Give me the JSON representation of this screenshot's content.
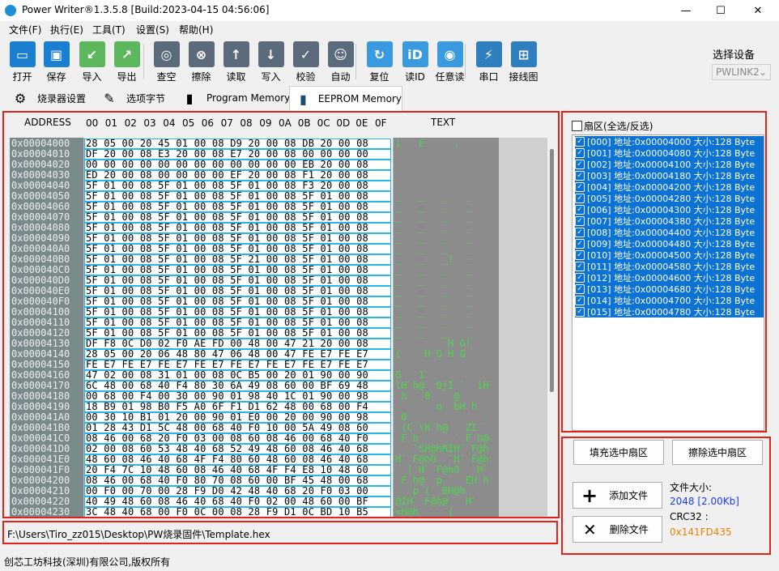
{
  "title": "Power Writer®1.3.5.8 [Build:2023-04-15 04:56:06]",
  "window": {
    "minimize": "—",
    "maximize": "☐",
    "close": "✕"
  },
  "menu": [
    "文件(F)",
    "执行(E)",
    "工具(T)",
    "设置(S)",
    "帮助(H)"
  ],
  "toolbar": [
    {
      "label": "打开",
      "icon": "folder-open-icon",
      "color": "#1b7fd1",
      "glyph": "▭"
    },
    {
      "label": "保存",
      "icon": "save-icon",
      "color": "#1b7fd1",
      "glyph": "▣"
    },
    {
      "label": "导入",
      "icon": "import-icon",
      "color": "#5db85d",
      "glyph": "↙"
    },
    {
      "label": "导出",
      "icon": "export-icon",
      "color": "#5db85d",
      "glyph": "↗"
    },
    {
      "label": "查空",
      "icon": "search-icon",
      "color": "#5b6b7b",
      "glyph": "◎"
    },
    {
      "label": "擦除",
      "icon": "erase-icon",
      "color": "#5b6b7b",
      "glyph": "⊗"
    },
    {
      "label": "读取",
      "icon": "read-icon",
      "color": "#5b6b7b",
      "glyph": "↑"
    },
    {
      "label": "写入",
      "icon": "write-icon",
      "color": "#5b6b7b",
      "glyph": "↓"
    },
    {
      "label": "校验",
      "icon": "verify-icon",
      "color": "#5b6b7b",
      "glyph": "✓"
    },
    {
      "label": "自动",
      "icon": "robot-icon",
      "color": "#5b6b7b",
      "glyph": "☺"
    },
    {
      "label": "复位",
      "icon": "reset-icon",
      "color": "#3a9ae0",
      "glyph": "↻"
    },
    {
      "label": "读ID",
      "icon": "id-icon",
      "color": "#3a9ae0",
      "glyph": "iD"
    },
    {
      "label": "任意读",
      "icon": "random-read-icon",
      "color": "#3a9ae0",
      "glyph": "◉"
    },
    {
      "label": "串口",
      "icon": "serial-port-icon",
      "color": "#2f7fbf",
      "glyph": "⚡"
    },
    {
      "label": "接线图",
      "icon": "wiring-diagram-icon",
      "color": "#2f7fbf",
      "glyph": "⊞"
    }
  ],
  "device": {
    "label": "选择设备",
    "value": "PWLINK2"
  },
  "tabs": [
    {
      "label": "烧录器设置",
      "icon": "gear-icon"
    },
    {
      "label": "选项字节",
      "icon": "options-icon"
    },
    {
      "label": "Program Memory",
      "icon": "chip-icon"
    },
    {
      "label": "EEPROM Memory",
      "icon": "chip-icon"
    }
  ],
  "mem_header": {
    "address": "ADDRESS",
    "cols": [
      "00",
      "01",
      "02",
      "03",
      "04",
      "05",
      "06",
      "07",
      "08",
      "09",
      "0A",
      "0B",
      "0C",
      "0D",
      "0E",
      "0F"
    ],
    "text": "TEXT"
  },
  "mem_rows": [
    {
      "a": "0x00004000",
      "h": "28 05 00 20 45 01 00 08 D9 20 00 08 DB 20 00 08",
      "t": "(   E     ."
    },
    {
      "a": "0x00004010",
      "h": "DF 20 00 08 E3 20 00 08 E7 20 00 08 00 00 00 00",
      "t": ""
    },
    {
      "a": "0x00004020",
      "h": "00 00 00 00 00 00 00 00 00 00 00 00 EB 20 00 08",
      "t": ""
    },
    {
      "a": "0x00004030",
      "h": "ED 20 00 08 00 00 00 00 EF 20 00 08 F1 20 00 08",
      "t": ""
    },
    {
      "a": "0x00004040",
      "h": "5F 01 00 08 5F 01 00 08 5F 01 00 08 F3 20 00 08",
      "t": ""
    },
    {
      "a": "0x00004050",
      "h": "5F 01 00 08 5F 01 00 08 5F 01 00 08 5F 01 00 08",
      "t": "_   _   _   _"
    },
    {
      "a": "0x00004060",
      "h": "5F 01 00 08 5F 01 00 08 5F 01 00 08 5F 01 00 08",
      "t": "_   _   _   _"
    },
    {
      "a": "0x00004070",
      "h": "5F 01 00 08 5F 01 00 08 5F 01 00 08 5F 01 00 08",
      "t": "_   _   _   _"
    },
    {
      "a": "0x00004080",
      "h": "5F 01 00 08 5F 01 00 08 5F 01 00 08 5F 01 00 08",
      "t": "_   _   _   _"
    },
    {
      "a": "0x00004090",
      "h": "5F 01 00 08 5F 01 00 08 5F 01 00 08 5F 01 00 08",
      "t": "_   _   _   _"
    },
    {
      "a": "0x000040A0",
      "h": "5F 01 00 08 5F 01 00 08 5F 01 00 08 5F 01 00 08",
      "t": "_   _   _   _"
    },
    {
      "a": "0x000040B0",
      "h": "5F 01 00 08 5F 01 00 08 5F 21 00 08 5F 01 00 08",
      "t": "_   _   _!  _"
    },
    {
      "a": "0x000040C0",
      "h": "5F 01 00 08 5F 01 00 08 5F 01 00 08 5F 01 00 08",
      "t": "_   _   _   _"
    },
    {
      "a": "0x000040D0",
      "h": "5F 01 00 08 5F 01 00 08 5F 01 00 08 5F 01 00 08",
      "t": "_   _   _   _"
    },
    {
      "a": "0x000040E0",
      "h": "5F 01 00 08 5F 01 00 08 5F 01 00 08 5F 01 00 08",
      "t": "_   _   _   _"
    },
    {
      "a": "0x000040F0",
      "h": "5F 01 00 08 5F 01 00 08 5F 01 00 08 5F 01 00 08",
      "t": "_   _   _   _"
    },
    {
      "a": "0x00004100",
      "h": "5F 01 00 08 5F 01 00 08 5F 01 00 08 5F 01 00 08",
      "t": "_   _   _   _"
    },
    {
      "a": "0x00004110",
      "h": "5F 01 00 08 5F 01 00 08 5F 01 00 08 5F 01 00 08",
      "t": "_   _   _   _"
    },
    {
      "a": "0x00004120",
      "h": "5F 01 00 08 5F 01 00 08 5F 01 00 08 5F 01 00 08",
      "t": "_   _   _   _"
    },
    {
      "a": "0x00004130",
      "h": "DF F8 0C D0 02 F0 AE FD 00 48 00 47 21 20 00 08",
      "t": "         H G!"
    },
    {
      "a": "0x00004140",
      "h": "28 05 00 20 06 48 80 47 06 48 00 47 FE E7 FE E7",
      "t": "(    H G H G"
    },
    {
      "a": "0x00004150",
      "h": "FE E7 FE E7 FE E7 FE E7 FE E7 FE E7 FE E7 FE E7",
      "t": ""
    },
    {
      "a": "0x00004160",
      "h": "47 02 00 08 31 01 00 08 0C B5 00 20 01 90 00 90",
      "t": "G   1"
    },
    {
      "a": "0x00004170",
      "h": "6C 48 00 68 40 F4 80 30 6A 49 08 60 00 BF 69 48",
      "t": "lH h@  0jI `  iH"
    },
    {
      "a": "0x00004180",
      "h": "00 68 00 F4 00 30 00 90 01 98 40 1C 01 90 00 98",
      "t": " h   0    @"
    },
    {
      "a": "0x00004190",
      "h": "18 B9 01 98 B0 F5 A0 6F F1 D1 62 48 00 68 00 F4",
      "t": "       o  bH h"
    },
    {
      "a": "0x000041A0",
      "h": "00 30 10 B1 01 20 00 90 01 E0 00 20 00 90 00 98",
      "t": " 0"
    },
    {
      "a": "0x000041B0",
      "h": "01 28 43 D1 5C 48 00 68 40 F0 10 00 5A 49 08 60",
      "t": " (C \\H h@   ZI `"
    },
    {
      "a": "0x000041C0",
      "h": "08 46 00 68 20 F0 03 00 08 60 08 46 00 68 40 F0",
      "t": " F h      ` F h@"
    },
    {
      "a": "0x000041D0",
      "h": "02 00 08 60 53 48 40 68 52 49 48 60 08 46 40 68",
      "t": "   `SH@hRIH` F@h"
    },
    {
      "a": "0x000041E0",
      "h": "48 60 08 46 40 68 4F F4 80 60 48 60 08 46 40 68",
      "t": "H` F@hO  `H` F@h"
    },
    {
      "a": "0x000041F0",
      "h": "20 F4 7C 10 48 60 08 46 40 68 4F F4 E8 10 48 60",
      "t": "  | H` F@hO   H`"
    },
    {
      "a": "0x00004200",
      "h": "08 46 00 68 40 F0 80 70 08 60 00 BF 45 48 00 68",
      "t": " F h@  p `  EH h"
    },
    {
      "a": "0x00004210",
      "h": "00 F0 00 70 00 28 F9 D0 42 48 40 68 20 F0 03 00",
      "t": "   p (  BH@h"
    },
    {
      "a": "0x00004220",
      "h": "40 49 48 60 08 46 40 68 40 F0 02 00 48 60 00 BF",
      "t": "@IH` F@h@   H`"
    },
    {
      "a": "0x00004230",
      "h": "3C 48 40 68 00 F0 0C 00 08 28 F9 D1 0C BD 10 B5",
      "t": "<H@h     ("
    }
  ],
  "sector_header": "扇区(全选/反选)",
  "sectors": [
    "[000] 地址:0x00004000 大小:128 Byte",
    "[001] 地址:0x00004080 大小:128 Byte",
    "[002] 地址:0x00004100 大小:128 Byte",
    "[003] 地址:0x00004180 大小:128 Byte",
    "[004] 地址:0x00004200 大小:128 Byte",
    "[005] 地址:0x00004280 大小:128 Byte",
    "[006] 地址:0x00004300 大小:128 Byte",
    "[007] 地址:0x00004380 大小:128 Byte",
    "[008] 地址:0x00004400 大小:128 Byte",
    "[009] 地址:0x00004480 大小:128 Byte",
    "[010] 地址:0x00004500 大小:128 Byte",
    "[011] 地址:0x00004580 大小:128 Byte",
    "[012] 地址:0x00004600 大小:128 Byte",
    "[013] 地址:0x00004680 大小:128 Byte",
    "[014] 地址:0x00004700 大小:128 Byte",
    "[015] 地址:0x00004780 大小:128 Byte"
  ],
  "buttons": {
    "fill": "填充选中扇区",
    "erase": "擦除选中扇区",
    "add": "添加文件",
    "delete": "删除文件"
  },
  "file_info": {
    "size_label": "文件大小:",
    "size_value": "2048 [2.00Kb]",
    "crc_label": "CRC32 :",
    "crc_value": "0x141FD435"
  },
  "path": "F:\\Users\\Tiro_zz015\\Desktop\\PW烧录固件\\Template.hex",
  "status": "创芯工坊科技(深圳)有限公司,版权所有",
  "colors": {
    "highlight": "#e2231a",
    "selection": "#0c73d4",
    "hex_border": "#29b6e8",
    "text_green": "#4cd64c"
  }
}
